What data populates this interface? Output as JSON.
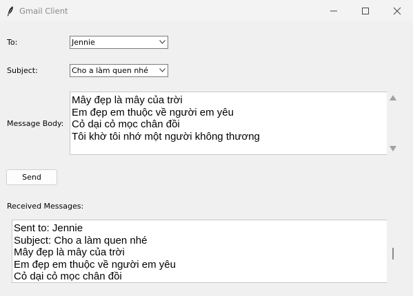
{
  "window": {
    "title": "Gmail Client",
    "app_icon": "feather-icon",
    "controls": [
      "minimize-icon",
      "maximize-icon",
      "close-icon"
    ]
  },
  "form": {
    "to_label": "To:",
    "to_value": "Jennie",
    "subject_label": "Subject:",
    "subject_value": "Cho a làm quen nhé",
    "body_label": "Message Body:",
    "body_lines": [
      "Mây đẹp là mây của trời",
      "Em đẹp em thuộc về người em yêu",
      "Cỏ dại cỏ mọc chân đồi",
      "Tôi khờ tôi nhớ một người không thương"
    ],
    "send_label": "Send"
  },
  "received": {
    "label": "Received Messages:",
    "lines": [
      "Sent to: Jennie",
      "Subject: Cho a làm quen nhé",
      "Mây đẹp là mây của trời",
      "Em đẹp em thuộc về người em yêu",
      "Cỏ dại cỏ mọc chân đồi"
    ]
  }
}
